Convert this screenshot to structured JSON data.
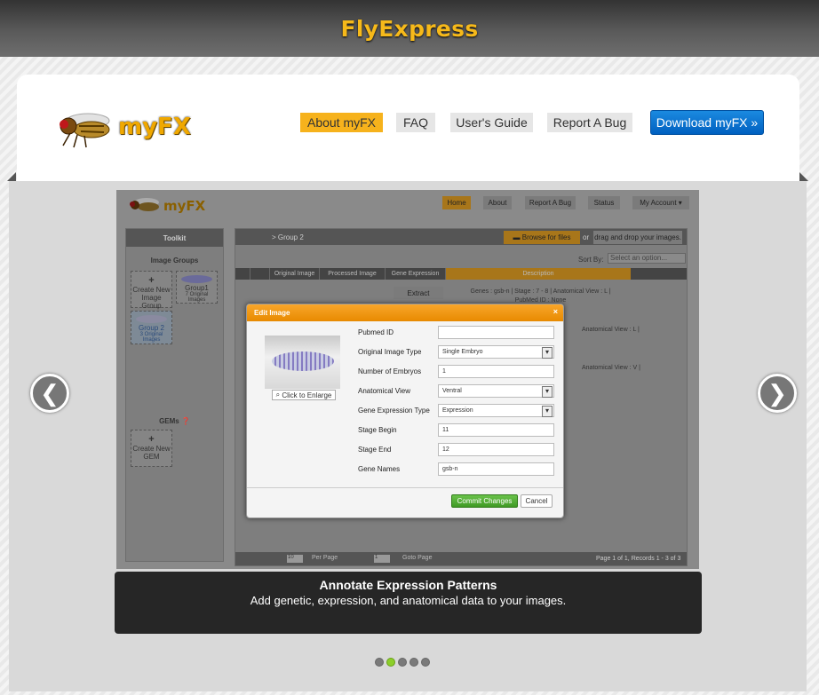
{
  "site": {
    "title": "FlyExpress",
    "logo_text": "myFX"
  },
  "nav": {
    "about": "About myFX",
    "faq": "FAQ",
    "guide": "User's Guide",
    "bug": "Report A Bug",
    "download": "Download myFX »"
  },
  "carousel": {
    "prev": "❮",
    "next": "❯",
    "caption_title": "Annotate Expression Patterns",
    "caption_text": "Add genetic, expression, and anatomical data to your images.",
    "active_dot": 2
  },
  "app": {
    "logo_text": "myFX",
    "nav": {
      "home": "Home",
      "about": "About",
      "bug": "Report A Bug",
      "status": "Status",
      "account": "My Account ▾"
    },
    "toolkit": "Toolkit",
    "image_groups": "Image Groups",
    "create_group": "Create New Image Group",
    "group1": "Group1",
    "group1_sub": "7 Original Images",
    "group2": "Group 2",
    "group2_sub": "3 Original Images",
    "gems": "GEMs",
    "create_gem": "Create New GEM",
    "breadcrumb": "> Group 2",
    "browse": "Browse for files",
    "or": "or",
    "drop": "drag and drop your images.",
    "sort_by": "Sort By:",
    "sort_placeholder": "Select an option...",
    "cols": [
      "Original Image",
      "Processed Image",
      "Gene Expression",
      "Description"
    ],
    "extract": "Extract",
    "row1_desc": "Genes : gsb-n | Stage : 7 - 8 | Anatomical View : L |",
    "row1_desc2": "PubMed ID : None",
    "row2_desc": "Anatomical View : L |",
    "row3_desc": "Anatomical View : V |",
    "per_page_val": "10",
    "per_page": "Per Page",
    "goto_val": "1",
    "goto": "Goto Page",
    "page_info": "Page 1 of 1, Records 1 - 3 of 3"
  },
  "modal": {
    "title": "Edit Image",
    "close": "×",
    "enlarge": "Click to Enlarge",
    "fields": [
      {
        "label": "Pubmed ID",
        "value": ""
      },
      {
        "label": "Original Image Type",
        "value": "Single Embryo"
      },
      {
        "label": "Number of Embryos",
        "value": "1"
      },
      {
        "label": "Anatomical View",
        "value": "Ventral"
      },
      {
        "label": "Gene Expression Type",
        "value": "Expression"
      },
      {
        "label": "Stage Begin",
        "value": "11"
      },
      {
        "label": "Stage End",
        "value": "12"
      },
      {
        "label": "Gene Names",
        "value": "gsb-n"
      }
    ],
    "commit": "Commit Changes",
    "cancel": "Cancel"
  }
}
